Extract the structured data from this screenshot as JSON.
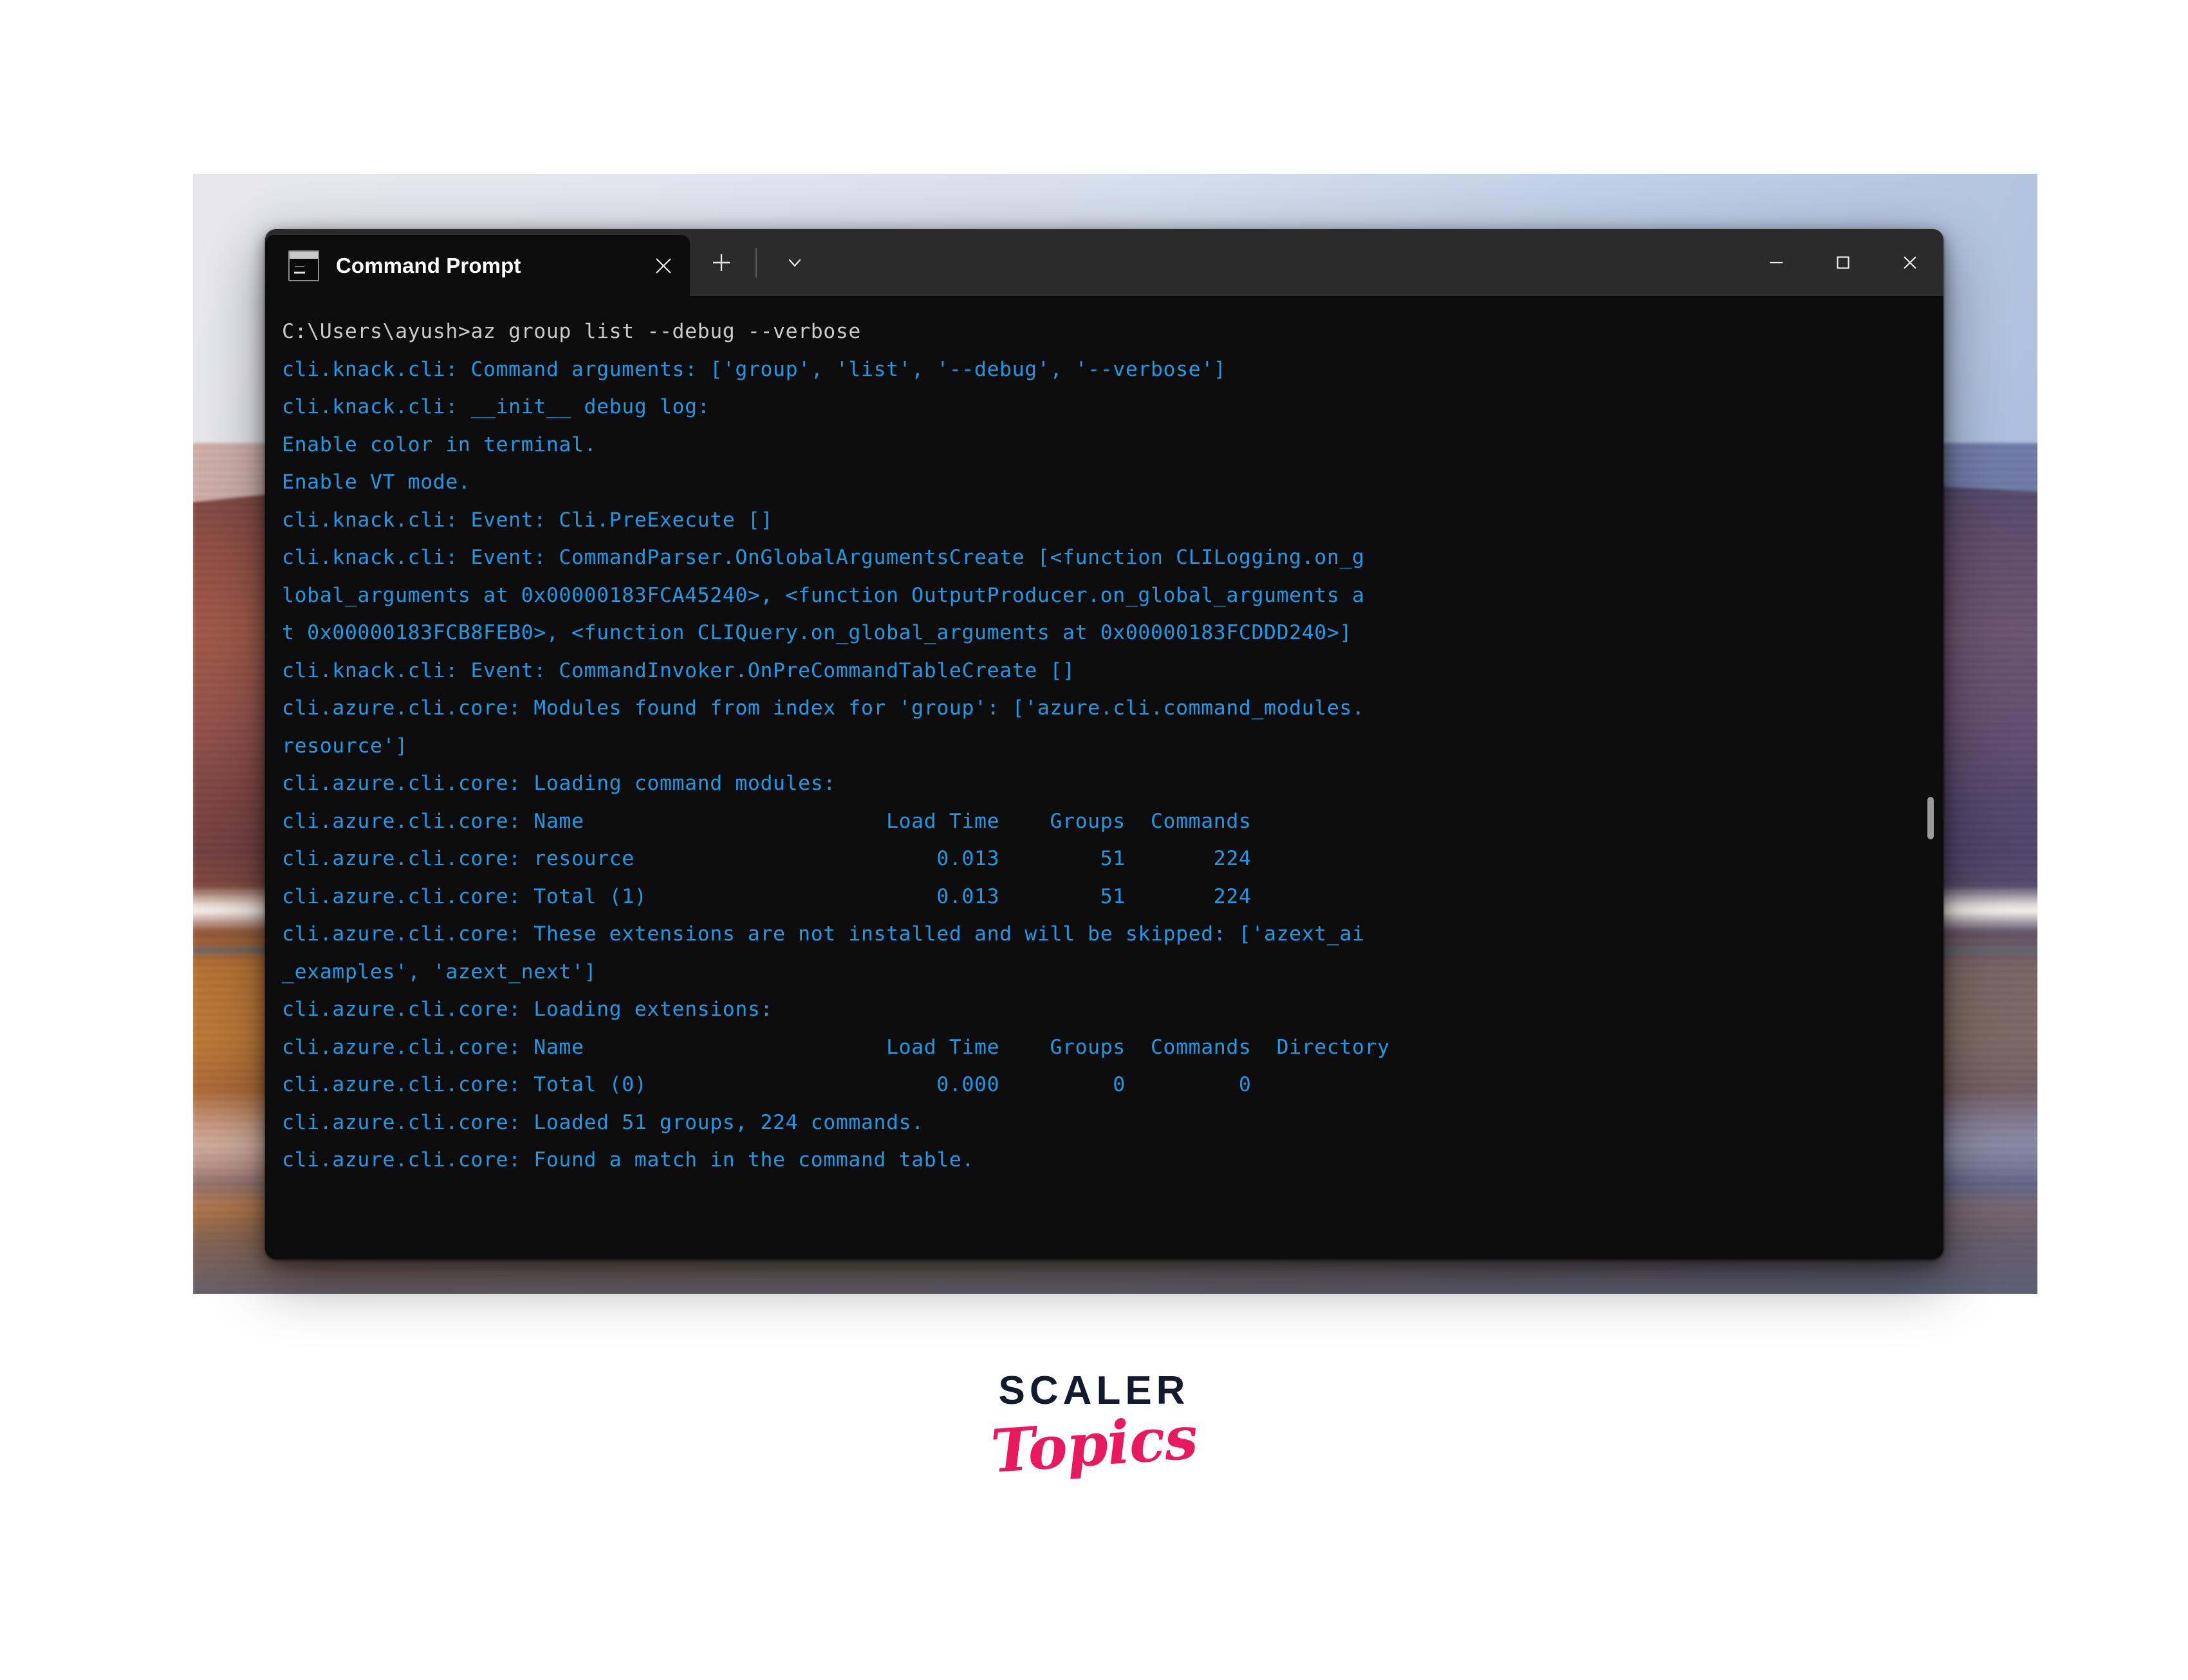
{
  "window": {
    "title": "Command Prompt",
    "tab_icon": "console-icon",
    "close_tab_label": "✕",
    "new_tab_label": "+",
    "dropdown_label": "∨",
    "minimize_label": "─",
    "maximize_label": "□",
    "close_label": "✕"
  },
  "terminal": {
    "prompt_color": "#ccc9c9",
    "debug_color": "#1d9ae6",
    "background": "#0c0c0c",
    "lines": [
      {
        "kind": "prompt",
        "text": "C:\\Users\\ayush>az group list --debug --verbose"
      },
      {
        "kind": "debug",
        "text": "cli.knack.cli: Command arguments: ['group', 'list', '--debug', '--verbose']"
      },
      {
        "kind": "debug",
        "text": "cli.knack.cli: __init__ debug log:"
      },
      {
        "kind": "debug",
        "text": "Enable color in terminal."
      },
      {
        "kind": "debug",
        "text": "Enable VT mode."
      },
      {
        "kind": "debug",
        "text": "cli.knack.cli: Event: Cli.PreExecute []"
      },
      {
        "kind": "debug",
        "text": "cli.knack.cli: Event: CommandParser.OnGlobalArgumentsCreate [<function CLILogging.on_g"
      },
      {
        "kind": "debug",
        "text": "lobal_arguments at 0x00000183FCA45240>, <function OutputProducer.on_global_arguments a"
      },
      {
        "kind": "debug",
        "text": "t 0x00000183FCB8FEB0>, <function CLIQuery.on_global_arguments at 0x00000183FCDDD240>]"
      },
      {
        "kind": "debug",
        "text": "cli.knack.cli: Event: CommandInvoker.OnPreCommandTableCreate []"
      },
      {
        "kind": "debug",
        "text": "cli.azure.cli.core: Modules found from index for 'group': ['azure.cli.command_modules."
      },
      {
        "kind": "debug",
        "text": "resource']"
      },
      {
        "kind": "debug",
        "text": "cli.azure.cli.core: Loading command modules:"
      },
      {
        "kind": "debug",
        "text": "cli.azure.cli.core: Name                        Load Time    Groups  Commands"
      },
      {
        "kind": "debug",
        "text": "cli.azure.cli.core: resource                        0.013        51       224"
      },
      {
        "kind": "debug",
        "text": "cli.azure.cli.core: Total (1)                       0.013        51       224"
      },
      {
        "kind": "debug",
        "text": "cli.azure.cli.core: These extensions are not installed and will be skipped: ['azext_ai"
      },
      {
        "kind": "debug",
        "text": "_examples', 'azext_next']"
      },
      {
        "kind": "debug",
        "text": "cli.azure.cli.core: Loading extensions:"
      },
      {
        "kind": "debug",
        "text": "cli.azure.cli.core: Name                        Load Time    Groups  Commands  Directory"
      },
      {
        "kind": "debug",
        "text": "cli.azure.cli.core: Total (0)                       0.000         0         0"
      },
      {
        "kind": "debug",
        "text": "cli.azure.cli.core: Loaded 51 groups, 224 commands."
      },
      {
        "kind": "debug",
        "text": "cli.azure.cli.core: Found a match in the command table."
      }
    ],
    "module_table": {
      "columns": [
        "Name",
        "Load Time",
        "Groups",
        "Commands"
      ],
      "rows": [
        {
          "name": "resource",
          "load_time": "0.013",
          "groups": "51",
          "commands": "224"
        },
        {
          "name": "Total (1)",
          "load_time": "0.013",
          "groups": "51",
          "commands": "224"
        }
      ]
    },
    "extension_table": {
      "columns": [
        "Name",
        "Load Time",
        "Groups",
        "Commands",
        "Directory"
      ],
      "rows": [
        {
          "name": "Total (0)",
          "load_time": "0.000",
          "groups": "0",
          "commands": "0",
          "directory": ""
        }
      ]
    },
    "summary": {
      "groups_loaded": "51",
      "commands_loaded": "224",
      "skipped_extensions": [
        "azext_ai_examples",
        "azext_next"
      ]
    }
  },
  "branding": {
    "scaler": "SCALER",
    "topics": "Topics",
    "scaler_color": "#141a2e",
    "topics_color": "#e8195f"
  }
}
